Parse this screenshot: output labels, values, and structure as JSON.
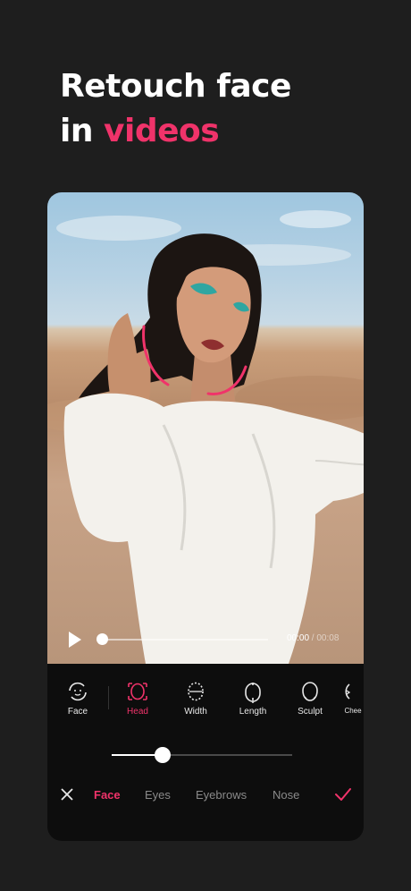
{
  "headline": {
    "line1": "Retouch face",
    "line2_prefix": "in",
    "line2_accent": "videos"
  },
  "player": {
    "time_current": "00:00",
    "time_separator": " / ",
    "time_total": "00:08",
    "progress": 0.0
  },
  "tools": [
    {
      "label": "Face",
      "icon": "face-rotate-icon"
    },
    {
      "label": "Head",
      "icon": "head-icon",
      "active": true
    },
    {
      "label": "Width",
      "icon": "face-width-icon"
    },
    {
      "label": "Length",
      "icon": "face-length-icon"
    },
    {
      "label": "Sculpt",
      "icon": "sculpt-icon"
    },
    {
      "label": "Chee",
      "icon": "cheek-icon"
    }
  ],
  "slider": {
    "value_fraction": 0.28
  },
  "tabs": [
    {
      "label": "Face",
      "active": true
    },
    {
      "label": "Eyes"
    },
    {
      "label": "Eyebrows"
    },
    {
      "label": "Nose"
    }
  ],
  "colors": {
    "accent": "#f0336a",
    "background": "#1e1e1e",
    "panel": "#0d0d0d"
  }
}
